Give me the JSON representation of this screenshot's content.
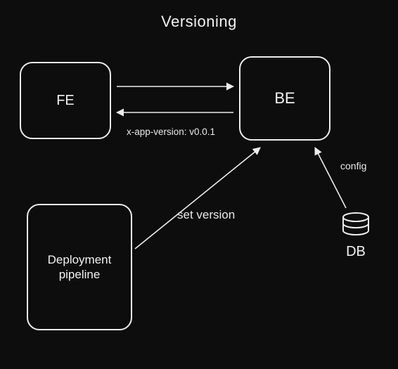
{
  "title": "Versioning",
  "nodes": {
    "fe": {
      "label": "FE"
    },
    "be": {
      "label": "BE"
    },
    "deployment": {
      "label": "Deployment\npipeline"
    },
    "db": {
      "label": "DB"
    }
  },
  "edges": {
    "fe_be_header": {
      "label": "x-app-version: v0.0.1"
    },
    "deployment_be": {
      "label": "set version"
    },
    "db_be": {
      "label": "config"
    }
  },
  "colors": {
    "background": "#0d0d0d",
    "stroke": "#ececec"
  }
}
